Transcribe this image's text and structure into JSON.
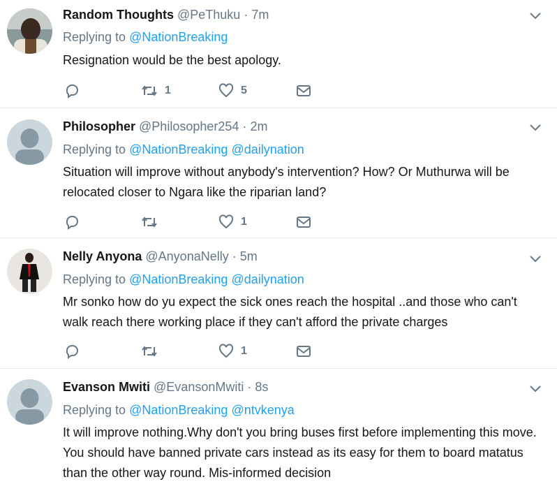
{
  "tweets": [
    {
      "name": "Random Thoughts",
      "handle": "@PeThuku",
      "time": "7m",
      "replying_label": "Replying to",
      "mentions": [
        "@NationBreaking"
      ],
      "text": "Resignation would be the best apology.",
      "retweets": "1",
      "likes": "5"
    },
    {
      "name": "Philosopher",
      "handle": "@Philosopher254",
      "time": "2m",
      "replying_label": "Replying to",
      "mentions": [
        "@NationBreaking",
        "@dailynation"
      ],
      "text": "Situation will improve without anybody's intervention? How? Or Muthurwa will be relocated closer to Ngara like the riparian land?",
      "retweets": "",
      "likes": "1"
    },
    {
      "name": "Nelly Anyona",
      "handle": "@AnyonaNelly",
      "time": "5m",
      "replying_label": "Replying to",
      "mentions": [
        "@NationBreaking",
        "@dailynation"
      ],
      "text": "Mr sonko how do yu expect the sick ones reach the hospital ..and those who can't walk reach there working place if they can't afford the private charges",
      "retweets": "",
      "likes": "1"
    },
    {
      "name": "Evanson Mwiti",
      "handle": "@EvansonMwiti",
      "time": "8s",
      "replying_label": "Replying to",
      "mentions": [
        "@NationBreaking",
        "@ntvkenya"
      ],
      "text": "It will improve nothing.Why don't you bring buses first before implementing this move. You should have banned private cars instead as its easy for them to board matatus than the other way round. Mis-informed decision",
      "retweets": "",
      "likes": ""
    }
  ],
  "icons": {
    "reply": "reply-icon",
    "retweet": "retweet-icon",
    "like": "heart-icon",
    "message": "direct-message-icon",
    "caret": "chevron-down-icon"
  },
  "colors": {
    "link": "#1da1f2",
    "secondary": "#657786",
    "border": "#e6ecf0"
  }
}
